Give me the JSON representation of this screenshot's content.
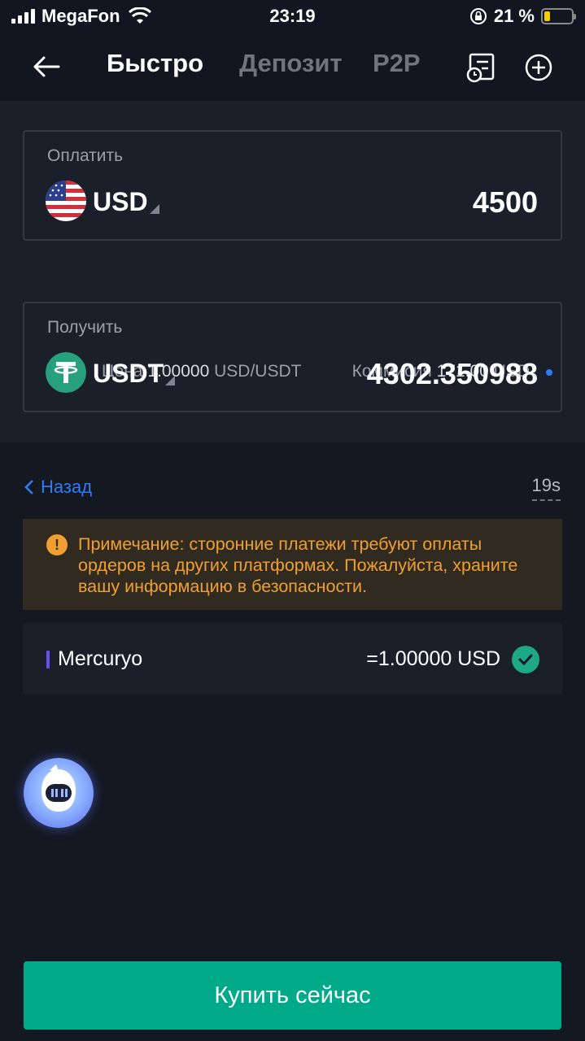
{
  "status_bar": {
    "carrier": "MegaFon",
    "time": "23:19",
    "battery_percent": "21 %",
    "battery_level": 0.21
  },
  "header": {
    "tabs": [
      {
        "label": "Быстро",
        "active": true
      },
      {
        "label": "Депозит",
        "active": false
      },
      {
        "label": "P2P",
        "active": false
      }
    ],
    "icons": [
      "back-arrow-icon",
      "order-history-icon",
      "add-circle-icon"
    ]
  },
  "pay": {
    "label": "Оплатить",
    "currency": "USD",
    "amount": "4500"
  },
  "rate": {
    "price_label": "Цена",
    "price_value": "1.00000",
    "price_unit": "USD/USDT",
    "fee_label": "Коммисия",
    "fee_value": "171.00",
    "fee_unit": "USD"
  },
  "receive": {
    "label": "Получить",
    "currency": "USDT",
    "amount": "4302.350988"
  },
  "nav": {
    "back_label": "Назад",
    "timer": "19s"
  },
  "notice": {
    "text": "Примечание: сторонние платежи требуют оплаты ордеров на других платформах. Пожалуйста, храните вашу информацию в безопасности."
  },
  "provider": {
    "name": "Mercuryo",
    "rate": "=1.00000 USD",
    "selected": true
  },
  "buy_button": {
    "label": "Купить сейчас"
  },
  "colors": {
    "background": "#141821",
    "panel": "#1b1f2a",
    "accent_green": "#00a98a",
    "link_blue": "#2f7df6",
    "warning_orange": "#f0a030"
  }
}
